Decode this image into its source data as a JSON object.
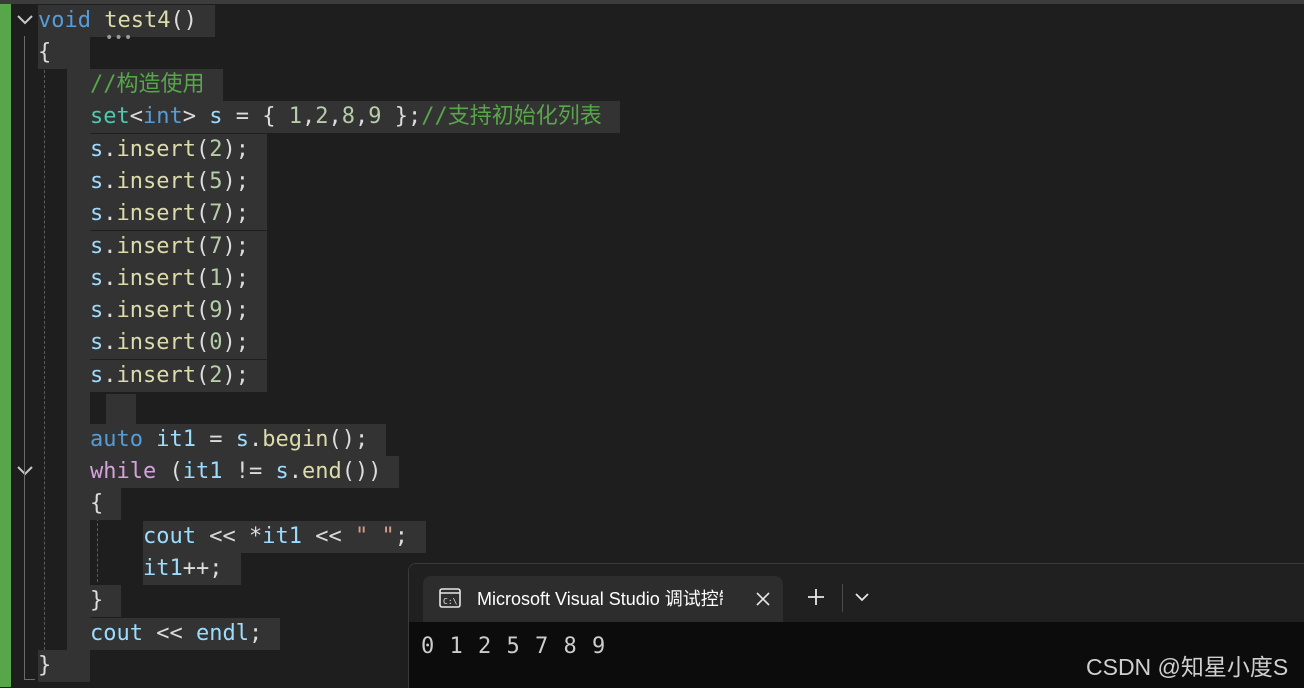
{
  "editor": {
    "lines": [
      {
        "indent": 0,
        "tokens": [
          {
            "t": "void",
            "c": "kw"
          },
          {
            "t": " ",
            "c": "pl"
          },
          {
            "t": "test4",
            "c": "fn"
          },
          {
            "t": "()",
            "c": "pl"
          }
        ]
      },
      {
        "indent": 0,
        "tokens": [
          {
            "t": "{",
            "c": "pl"
          }
        ]
      },
      {
        "indent": 1,
        "tokens": [
          {
            "t": "//构造使用",
            "c": "cm"
          }
        ]
      },
      {
        "indent": 1,
        "tokens": [
          {
            "t": "set",
            "c": "ty"
          },
          {
            "t": "<",
            "c": "pl"
          },
          {
            "t": "int",
            "c": "kw"
          },
          {
            "t": "> ",
            "c": "pl"
          },
          {
            "t": "s",
            "c": "var"
          },
          {
            "t": " = { ",
            "c": "pl"
          },
          {
            "t": "1",
            "c": "num"
          },
          {
            "t": ",",
            "c": "pl"
          },
          {
            "t": "2",
            "c": "num"
          },
          {
            "t": ",",
            "c": "pl"
          },
          {
            "t": "8",
            "c": "num"
          },
          {
            "t": ",",
            "c": "pl"
          },
          {
            "t": "9",
            "c": "num"
          },
          {
            "t": " };",
            "c": "pl"
          },
          {
            "t": "//支持初始化列表",
            "c": "cm"
          }
        ]
      },
      {
        "indent": 1,
        "tokens": [
          {
            "t": "s",
            "c": "var"
          },
          {
            "t": ".",
            "c": "pl"
          },
          {
            "t": "insert",
            "c": "fn"
          },
          {
            "t": "(",
            "c": "pl"
          },
          {
            "t": "2",
            "c": "num"
          },
          {
            "t": ");",
            "c": "pl"
          }
        ]
      },
      {
        "indent": 1,
        "tokens": [
          {
            "t": "s",
            "c": "var"
          },
          {
            "t": ".",
            "c": "pl"
          },
          {
            "t": "insert",
            "c": "fn"
          },
          {
            "t": "(",
            "c": "pl"
          },
          {
            "t": "5",
            "c": "num"
          },
          {
            "t": ");",
            "c": "pl"
          }
        ]
      },
      {
        "indent": 1,
        "tokens": [
          {
            "t": "s",
            "c": "var"
          },
          {
            "t": ".",
            "c": "pl"
          },
          {
            "t": "insert",
            "c": "fn"
          },
          {
            "t": "(",
            "c": "pl"
          },
          {
            "t": "7",
            "c": "num"
          },
          {
            "t": ");",
            "c": "pl"
          }
        ]
      },
      {
        "indent": 1,
        "tokens": [
          {
            "t": "s",
            "c": "var"
          },
          {
            "t": ".",
            "c": "pl"
          },
          {
            "t": "insert",
            "c": "fn"
          },
          {
            "t": "(",
            "c": "pl"
          },
          {
            "t": "7",
            "c": "num"
          },
          {
            "t": ");",
            "c": "pl"
          }
        ]
      },
      {
        "indent": 1,
        "tokens": [
          {
            "t": "s",
            "c": "var"
          },
          {
            "t": ".",
            "c": "pl"
          },
          {
            "t": "insert",
            "c": "fn"
          },
          {
            "t": "(",
            "c": "pl"
          },
          {
            "t": "1",
            "c": "num"
          },
          {
            "t": ");",
            "c": "pl"
          }
        ]
      },
      {
        "indent": 1,
        "tokens": [
          {
            "t": "s",
            "c": "var"
          },
          {
            "t": ".",
            "c": "pl"
          },
          {
            "t": "insert",
            "c": "fn"
          },
          {
            "t": "(",
            "c": "pl"
          },
          {
            "t": "9",
            "c": "num"
          },
          {
            "t": ");",
            "c": "pl"
          }
        ]
      },
      {
        "indent": 1,
        "tokens": [
          {
            "t": "s",
            "c": "var"
          },
          {
            "t": ".",
            "c": "pl"
          },
          {
            "t": "insert",
            "c": "fn"
          },
          {
            "t": "(",
            "c": "pl"
          },
          {
            "t": "0",
            "c": "num"
          },
          {
            "t": ");",
            "c": "pl"
          }
        ]
      },
      {
        "indent": 1,
        "tokens": [
          {
            "t": "s",
            "c": "var"
          },
          {
            "t": ".",
            "c": "pl"
          },
          {
            "t": "insert",
            "c": "fn"
          },
          {
            "t": "(",
            "c": "pl"
          },
          {
            "t": "2",
            "c": "num"
          },
          {
            "t": ");",
            "c": "pl"
          }
        ]
      },
      {
        "indent": 1,
        "tokens": []
      },
      {
        "indent": 1,
        "tokens": [
          {
            "t": "auto",
            "c": "kw"
          },
          {
            "t": " ",
            "c": "pl"
          },
          {
            "t": "it1",
            "c": "var"
          },
          {
            "t": " = ",
            "c": "pl"
          },
          {
            "t": "s",
            "c": "var"
          },
          {
            "t": ".",
            "c": "pl"
          },
          {
            "t": "begin",
            "c": "fn"
          },
          {
            "t": "();",
            "c": "pl"
          }
        ]
      },
      {
        "indent": 1,
        "tokens": [
          {
            "t": "while",
            "c": "kw2"
          },
          {
            "t": " (",
            "c": "pl"
          },
          {
            "t": "it1",
            "c": "var"
          },
          {
            "t": " != ",
            "c": "pl"
          },
          {
            "t": "s",
            "c": "var"
          },
          {
            "t": ".",
            "c": "pl"
          },
          {
            "t": "end",
            "c": "fn"
          },
          {
            "t": "())",
            "c": "pl"
          }
        ]
      },
      {
        "indent": 1,
        "tokens": [
          {
            "t": "{",
            "c": "pl"
          }
        ]
      },
      {
        "indent": 2,
        "tokens": [
          {
            "t": "cout",
            "c": "var"
          },
          {
            "t": " << *",
            "c": "pl"
          },
          {
            "t": "it1",
            "c": "var"
          },
          {
            "t": " << ",
            "c": "pl"
          },
          {
            "t": "\" \"",
            "c": "str"
          },
          {
            "t": ";",
            "c": "pl"
          }
        ]
      },
      {
        "indent": 2,
        "tokens": [
          {
            "t": "it1",
            "c": "var"
          },
          {
            "t": "++;",
            "c": "pl"
          }
        ]
      },
      {
        "indent": 1,
        "tokens": [
          {
            "t": "}",
            "c": "pl"
          }
        ]
      },
      {
        "indent": 1,
        "tokens": [
          {
            "t": "cout",
            "c": "var"
          },
          {
            "t": " << ",
            "c": "pl"
          },
          {
            "t": "endl",
            "c": "var"
          },
          {
            "t": ";",
            "c": "pl"
          }
        ]
      },
      {
        "indent": 0,
        "tokens": [
          {
            "t": "}",
            "c": "pl"
          }
        ]
      }
    ],
    "fold_icons": [
      "chevron-down-icon",
      "chevron-down-icon"
    ],
    "colors": {
      "background": "#1e1e1e",
      "selection": "#333333",
      "gutter_change_bar": "#57a64a",
      "keyword": "#569cd6",
      "control_keyword": "#d8a0df",
      "type": "#4ec9b0",
      "function": "#dcdcaa",
      "variable": "#9cdcfe",
      "number": "#b5cea8",
      "comment": "#57a64a",
      "string": "#d69d85"
    }
  },
  "terminal": {
    "tab_title": "Microsoft Visual Studio 调试控制台",
    "tab_icon": "console-icon",
    "close_icon": "close-icon",
    "new_tab_icon": "plus-icon",
    "dropdown_icon": "chevron-down-icon",
    "output": "0 1 2 5 7 8 9"
  },
  "watermark": "CSDN @知星小度S"
}
